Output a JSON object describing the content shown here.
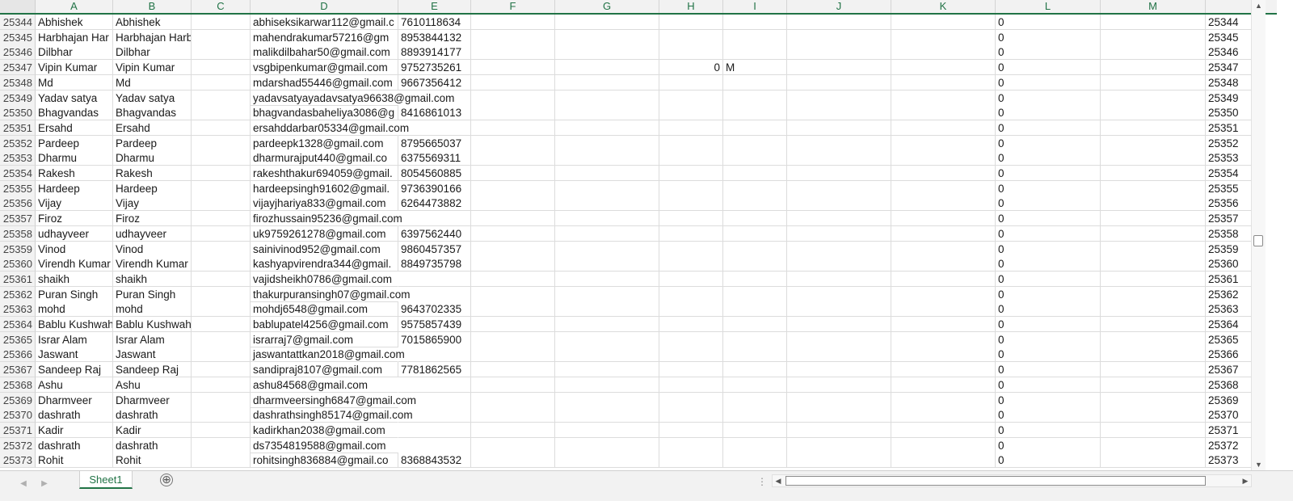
{
  "columns": [
    "A",
    "B",
    "C",
    "D",
    "E",
    "F",
    "G",
    "H",
    "I",
    "J",
    "K",
    "L",
    "M"
  ],
  "rows": [
    {
      "n": "25344",
      "a": "Abhishek",
      "b": "Abhishek",
      "d": "abhiseksikarwar112@gmail.c",
      "e": "7610118634",
      "l": "0"
    },
    {
      "n": "25345",
      "a": "Harbhajan Har",
      "b": "Harbhajan Harbhajan",
      "d": "mahendrakumar57216@gm",
      "e": "8953844132",
      "l": "0"
    },
    {
      "n": "25346",
      "a": "Dilbhar",
      "b": "Dilbhar",
      "d": "malikdilbahar50@gmail.com",
      "e": "8893914177",
      "l": "0"
    },
    {
      "n": "25347",
      "a": "Vipin Kumar",
      "b": "Vipin Kumar",
      "d": "vsgbipenkumar@gmail.com",
      "e": "9752735261",
      "h": "0",
      "i": "M",
      "l": "0"
    },
    {
      "n": "25348",
      "a": "Md",
      "b": "Md",
      "d": "mdarshad55446@gmail.com",
      "e": "9667356412",
      "l": "0"
    },
    {
      "n": "25349",
      "a": "Yadav satya",
      "b": "Yadav satya",
      "d": "yadavsatyayadavsatya96638@gmail.com",
      "e": "",
      "l": "0"
    },
    {
      "n": "25350",
      "a": "Bhagvandas",
      "b": "Bhagvandas",
      "d": "bhagvandasbaheliya3086@g",
      "e": "8416861013",
      "l": "0"
    },
    {
      "n": "25351",
      "a": "Ersahd",
      "b": "Ersahd",
      "d": "ersahddarbar05334@gmail.com",
      "e": "",
      "l": "0"
    },
    {
      "n": "25352",
      "a": "Pardeep",
      "b": "Pardeep",
      "d": "pardeepk1328@gmail.com",
      "e": "8795665037",
      "l": "0"
    },
    {
      "n": "25353",
      "a": "Dharmu",
      "b": "Dharmu",
      "d": "dharmurajput440@gmail.co",
      "e": "6375569311",
      "l": "0"
    },
    {
      "n": "25354",
      "a": "Rakesh",
      "b": "Rakesh",
      "d": "rakeshthakur694059@gmail.",
      "e": "8054560885",
      "l": "0"
    },
    {
      "n": "25355",
      "a": "Hardeep",
      "b": "Hardeep",
      "d": "hardeepsingh91602@gmail.",
      "e": "9736390166",
      "l": "0"
    },
    {
      "n": "25356",
      "a": "Vijay",
      "b": "Vijay",
      "d": "vijayjhariya833@gmail.com",
      "e": "6264473882",
      "l": "0"
    },
    {
      "n": "25357",
      "a": "Firoz",
      "b": "Firoz",
      "d": "firozhussain95236@gmail.com",
      "e": "",
      "l": "0"
    },
    {
      "n": "25358",
      "a": "udhayveer",
      "b": "udhayveer",
      "d": "uk9759261278@gmail.com",
      "e": "6397562440",
      "l": "0"
    },
    {
      "n": "25359",
      "a": "Vinod",
      "b": "Vinod",
      "d": "sainivinod952@gmail.com",
      "e": "9860457357",
      "l": "0"
    },
    {
      "n": "25360",
      "a": "Virendh Kumar",
      "b": "Virendh Kumar",
      "d": "kashyapvirendra344@gmail.",
      "e": "8849735798",
      "l": "0"
    },
    {
      "n": "25361",
      "a": "shaikh",
      "b": "shaikh",
      "d": "vajidsheikh0786@gmail.com",
      "e": "",
      "l": "0"
    },
    {
      "n": "25362",
      "a": "Puran Singh",
      "b": "Puran Singh",
      "d": "thakurpuransingh07@gmail.com",
      "e": "",
      "l": "0"
    },
    {
      "n": "25363",
      "a": "mohd",
      "b": "mohd",
      "d": "mohdj6548@gmail.com",
      "e": "9643702335",
      "l": "0"
    },
    {
      "n": "25364",
      "a": "Bablu Kushwah",
      "b": "Bablu Kushwaha",
      "d": "bablupatel4256@gmail.com",
      "e": "9575857439",
      "l": "0"
    },
    {
      "n": "25365",
      "a": "Israr Alam",
      "b": "Israr Alam",
      "d": "israrraj7@gmail.com",
      "e": "7015865900",
      "l": "0"
    },
    {
      "n": "25366",
      "a": "Jaswant",
      "b": "Jaswant",
      "d": "jaswantattkan2018@gmail.com",
      "e": "",
      "l": "0"
    },
    {
      "n": "25367",
      "a": "Sandeep Raj",
      "b": "Sandeep Raj",
      "d": "sandipraj8107@gmail.com",
      "e": "7781862565",
      "l": "0"
    },
    {
      "n": "25368",
      "a": "Ashu",
      "b": "Ashu",
      "d": "ashu84568@gmail.com",
      "e": "",
      "l": "0"
    },
    {
      "n": "25369",
      "a": "Dharmveer",
      "b": "Dharmveer",
      "d": "dharmveersingh6847@gmail.com",
      "e": "",
      "l": "0"
    },
    {
      "n": "25370",
      "a": "dashrath",
      "b": "dashrath",
      "d": "dashrathsingh85174@gmail.com",
      "e": "",
      "l": "0"
    },
    {
      "n": "25371",
      "a": "Kadir",
      "b": "Kadir",
      "d": "kadirkhan2038@gmail.com",
      "e": "",
      "l": "0"
    },
    {
      "n": "25372",
      "a": "dashrath",
      "b": "dashrath",
      "d": "ds7354819588@gmail.com",
      "e": "",
      "l": "0"
    },
    {
      "n": "25373",
      "a": "Rohit",
      "b": "Rohit",
      "d": "rohitsingh836884@gmail.co",
      "e": "8368843532",
      "l": "0"
    }
  ],
  "sheet_tab": "Sheet1",
  "add_sheet": "⊕",
  "split_handle": "⋮",
  "colors": {
    "accent": "#217346",
    "grid": "#dcdcdc",
    "header_bg": "#f2f2f2"
  }
}
